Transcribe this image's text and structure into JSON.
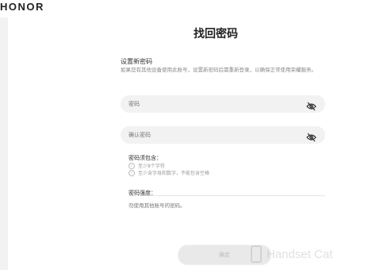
{
  "header": {
    "brand": "HONOR"
  },
  "page": {
    "title": "找回密码",
    "section_title": "设置新密码",
    "description": "如果您有其他设备使用此账号，设置新密码后需重新登录，以确保正常使用荣耀服务。"
  },
  "form": {
    "password_placeholder": "密码",
    "confirm_placeholder": "确认密码",
    "password_icon": "eye-hidden-icon",
    "confirm_icon": "eye-hidden-icon"
  },
  "rules": {
    "heading": "密码须包含：",
    "items": [
      "至少8个字符",
      "至少含字母和数字，不能包含空格"
    ]
  },
  "strength": {
    "label": "密码强度："
  },
  "notice": "勿使用其他账号的密码。",
  "submit": {
    "label": "确定"
  },
  "watermark": {
    "text": "Handset Cat"
  },
  "colors": {
    "card": "#ffffff",
    "background": "#f2f2f2",
    "field": "#f2f2f2"
  }
}
